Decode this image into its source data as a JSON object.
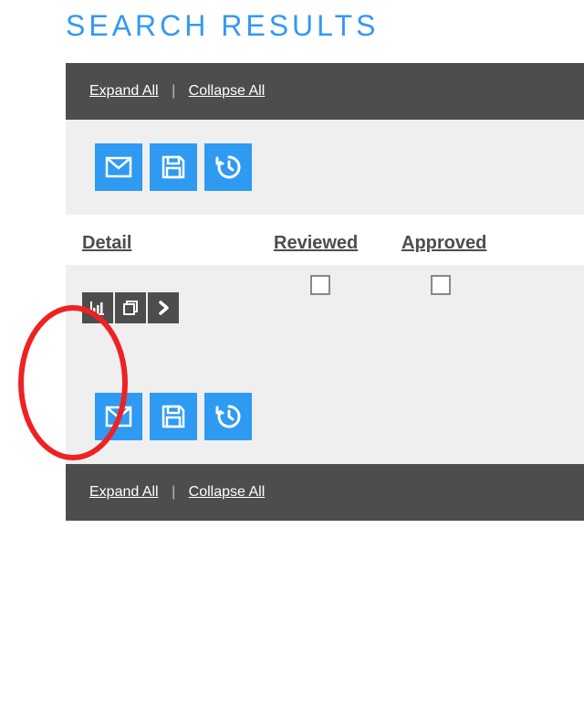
{
  "title": "SEARCH RESULTS",
  "controls": {
    "expand": "Expand All",
    "collapse": "Collapse All",
    "separator": "|"
  },
  "toolbar": {
    "icons": [
      "mail-icon",
      "save-icon",
      "history-icon"
    ]
  },
  "columns": {
    "detail": "Detail",
    "reviewed": "Reviewed",
    "approved": "Approved"
  },
  "row": {
    "detail_icons": [
      "chart-icon",
      "copy-icon",
      "chevron-right-icon"
    ],
    "reviewed_checked": false,
    "approved_checked": false
  },
  "colors": {
    "accent": "#2e9af2",
    "title": "#3399f2",
    "dark": "#4d4d4d",
    "light": "#efefef",
    "annotation": "#e22"
  }
}
